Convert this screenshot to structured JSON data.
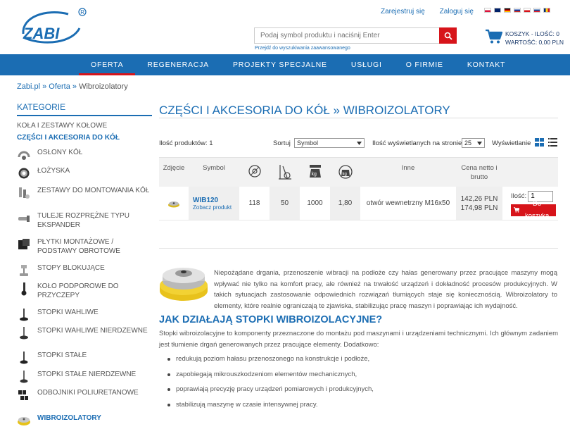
{
  "header": {
    "logo_text": "ZABI",
    "register_link": "Zarejestruj się",
    "login_link": "Zaloguj się",
    "search_placeholder": "Podaj symbol produktu i naciśnij Enter",
    "advanced_search": "Przejdź do wyszukiwania zaawansowanego",
    "cart_line1": "KOSZYK - ILOŚĆ: 0",
    "cart_line2": "WARTOŚĆ: 0,00 PLN",
    "flags": [
      "pl",
      "en",
      "de",
      "ru",
      "cz",
      "sk",
      "ro"
    ]
  },
  "nav": {
    "items": [
      "OFERTA",
      "REGENERACJA",
      "PROJEKTY SPECJALNE",
      "USŁUGI",
      "O FIRMIE",
      "KONTAKT"
    ]
  },
  "breadcrumb": {
    "home": "Zabi.pl",
    "sep1": "»",
    "offer": "Oferta",
    "sep2": "»",
    "current": "Wibroizolatory"
  },
  "sidebar": {
    "title": "KATEGORIE",
    "top1": "KOŁA I ZESTAWY KOŁOWE",
    "top2": "CZĘŚCI I AKCESORIA DO KÓŁ",
    "items": [
      "OSŁONY KÓŁ",
      "ŁOŻYSKA",
      "ZESTAWY DO MONTOWANIA KÓŁ",
      "TULEJE ROZPRĘŻNE TYPU EKSPANDER",
      "PŁYTKI MONTAŻOWE / PODSTAWY OBROTOWE",
      "STOPY BLOKUJĄCE",
      "KOŁO PODPOROWE DO PRZYCZEPY",
      "STOPKI WAHLIWE",
      "STOPKI WAHLIWE NIERDZEWNE",
      "STOPKI STAŁE",
      "STOPKI STAŁE NIERDZEWNE",
      "ODBOJNIKI POLIURETANOWE",
      "WIBROIZOLATORY"
    ]
  },
  "main": {
    "title": "CZĘŚCI I AKCESORIA DO KÓŁ » WIBROIZOLATORY",
    "count_label": "Ilość produktów: 1",
    "sort_label": "Sortuj",
    "sort_value": "Symbol",
    "perpage_label": "Ilość wyświetlanych na stronie",
    "perpage_value": "25",
    "view_label": "Wyświetlanie"
  },
  "table": {
    "headers": {
      "image": "Zdjęcie",
      "symbol": "Symbol",
      "other": "Inne",
      "price": "Cena netto i brutto"
    },
    "row": {
      "symbol": "WIB120",
      "see_product": "Zobacz produkt",
      "v1": "118",
      "v2": "50",
      "v3": "1000",
      "v4": "1,80",
      "other": "otwór wewnetrzny M16x50",
      "price_net": "142,26 PLN",
      "price_gross": "174,98 PLN",
      "qty_label": "Ilość:",
      "qty_value": "1",
      "add_to_cart": "Do koszyka"
    }
  },
  "content": {
    "intro": "Niepożądane drgania, przenoszenie wibracji na podłoże czy hałas generowany przez pracujące maszyny mogą wpływać nie tylko na komfort pracy, ale również na trwałość urządzeń i dokładność procesów produkcyjnych. W takich sytuacjach zastosowanie odpowiednich rozwiązań tłumiących staje się koniecznością. Wibroizolatory to elementy, które realnie ograniczają te zjawiska, stabilizując pracę maszyn i poprawiając ich wydajność.",
    "heading": "JAK DZIAŁAJĄ STOPKI WIBROIZOLACYJNE?",
    "paragraph": "Stopki wibroizolacyjne to komponenty przeznaczone do montażu pod maszynami i urządzeniami technicznymi. Ich głównym zadaniem jest tłumienie drgań generowanych przez pracujące elementy. Dodatkowo:",
    "bullets": [
      "redukują poziom hałasu przenoszonego na konstrukcje i podłoże,",
      "zapobiegają mikrouszkodzeniom elementów mechanicznych,",
      "poprawiają precyzję pracy urządzeń pomiarowych i produkcyjnych,",
      "stabilizują maszynę w czasie intensywnej pracy."
    ]
  },
  "colors": {
    "brand_blue": "#1b6db3",
    "accent_red": "#d7141a"
  }
}
